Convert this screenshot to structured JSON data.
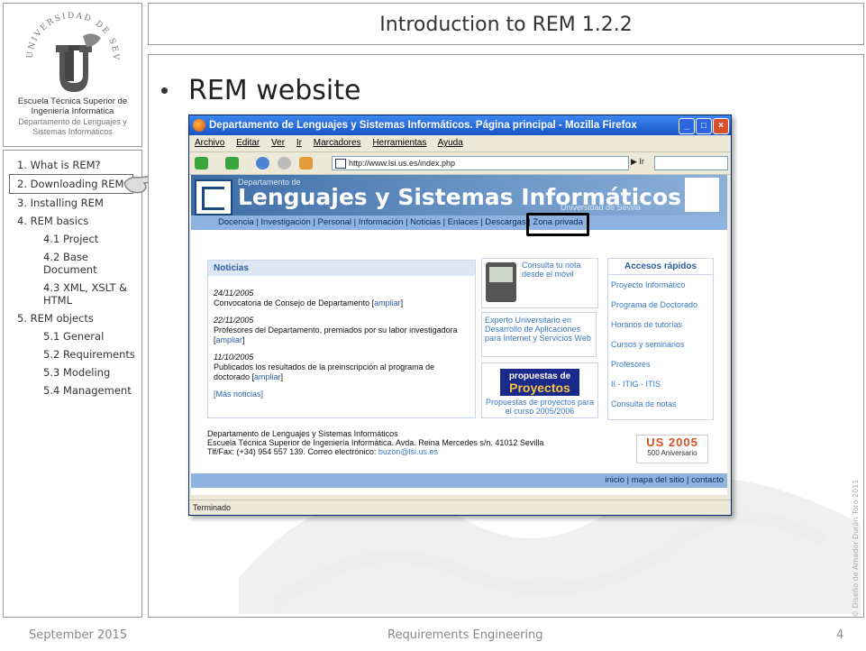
{
  "slide": {
    "title": "Introduction to REM 1.2.2",
    "bullet": "REM website",
    "footer_left": "September 2015",
    "footer_center": "Requirements Engineering",
    "page_number": "4",
    "side_credit": "© Diseño de Amador Durán Toro 2011"
  },
  "logo": {
    "seal_text": "UNIVERSIDAD DE SEVILLA",
    "school": "Escuela Técnica Superior de Ingeniería Informática",
    "dept": "Departamento de Lenguajes y Sistemas Informáticos"
  },
  "nav": {
    "items": [
      {
        "label": "1.  What is REM?"
      },
      {
        "label": "2.  Downloading REM"
      },
      {
        "label": "3.  Installing REM"
      },
      {
        "label": "4.  REM basics"
      },
      {
        "label": "4.1 Project"
      },
      {
        "label": "4.2 Base Document"
      },
      {
        "label": "4.3 XML, XSLT & HTML"
      },
      {
        "label": "5. REM objects"
      },
      {
        "label": "5.1 General"
      },
      {
        "label": "5.2 Requirements"
      },
      {
        "label": "5.3 Modeling"
      },
      {
        "label": "5.4 Management"
      }
    ]
  },
  "browser": {
    "title": "Departamento de Lenguajes y Sistemas Informáticos. Página principal - Mozilla Firefox",
    "menu": [
      "Archivo",
      "Editar",
      "Ver",
      "Ir",
      "Marcadores",
      "Herramientas",
      "Ayuda"
    ],
    "url": "http://www.lsi.us.es/index.php",
    "go_label": "Ir",
    "status": "Terminado"
  },
  "site": {
    "dept_label": "Departamento de",
    "name": "Lenguajes y Sistemas Informáticos",
    "university": "Universidad de Sevilla",
    "nav_text": "Docencia | Investigación | Personal | Información | Noticias | Enlaces | Descargas | Zona privada",
    "news": {
      "heading": "Noticias",
      "items": [
        {
          "date": "24/11/2005",
          "text": "Convocatoria de Consejo de Departamento [",
          "link": "ampliar"
        },
        {
          "date": "22/11/2005",
          "text": "Profesores del Departamento, premiados por su labor investigadora [",
          "link": "ampliar"
        },
        {
          "date": "11/10/2005",
          "text": "Publicados los resultados de la preinscripción al programa de doctorado [",
          "link": "ampliar"
        }
      ],
      "more": "[Más noticias]"
    },
    "mobile_text": "Consulta tu nota desde el móvil",
    "expert_text": "Experto Universitario en Desarrollo de Aplicaciones para Internet y Servicios Web",
    "prop_line1": "propuestas de",
    "prop_line2": "Proyectos",
    "prop_caption": "Propuestas de proyectos para el curso 2005/2006",
    "quick": {
      "heading": "Accesos rápidos",
      "items": [
        "Proyecto Informático",
        "Programa de Doctorado",
        "Horarios de tutorías",
        "Cursos y seminarios",
        "Profesores",
        "II - ITIG - ITIS",
        "Consulta de notas"
      ]
    },
    "footer_lines": [
      "Departamento de Lenguajes y Sistemas Informáticos",
      "Escuela Técnica Superior de Ingeniería Informática. Avda. Reina Mercedes s/n. 41012 Sevilla",
      "Tlf/Fax: (+34) 954 557 139. Correo electrónico: "
    ],
    "footer_email": "buzon@lsi.us.es",
    "us_logo_top": "US 2005",
    "us_logo_bottom": "500 Aniversario",
    "bottom_links": "inicio | mapa del sitio | contacto"
  }
}
